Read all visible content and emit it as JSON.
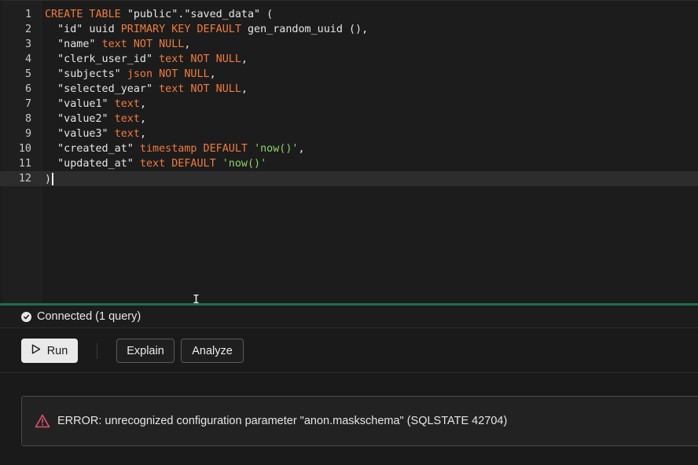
{
  "editor": {
    "lines": [
      {
        "n": "1",
        "tokens": [
          [
            "kw",
            "CREATE TABLE "
          ],
          [
            "str",
            "\"public\".\"saved_data\" ("
          ]
        ]
      },
      {
        "n": "2",
        "tokens": [
          [
            "str",
            "  \"id\" uuid "
          ],
          [
            "kw",
            "PRIMARY KEY DEFAULT "
          ],
          [
            "fn",
            "gen_random_uuid (),"
          ]
        ]
      },
      {
        "n": "3",
        "tokens": [
          [
            "str",
            "  \"name\" "
          ],
          [
            "kw",
            "text NOT NULL"
          ],
          [
            "str",
            ","
          ]
        ]
      },
      {
        "n": "4",
        "tokens": [
          [
            "str",
            "  \"clerk_user_id\" "
          ],
          [
            "kw",
            "text NOT NULL"
          ],
          [
            "str",
            ","
          ]
        ]
      },
      {
        "n": "5",
        "tokens": [
          [
            "str",
            "  \"subjects\" "
          ],
          [
            "kw",
            "json NOT NULL"
          ],
          [
            "str",
            ","
          ]
        ]
      },
      {
        "n": "6",
        "tokens": [
          [
            "str",
            "  \"selected_year\" "
          ],
          [
            "kw",
            "text NOT NULL"
          ],
          [
            "str",
            ","
          ]
        ]
      },
      {
        "n": "7",
        "tokens": [
          [
            "str",
            "  \"value1\" "
          ],
          [
            "kw",
            "text"
          ],
          [
            "str",
            ","
          ]
        ]
      },
      {
        "n": "8",
        "tokens": [
          [
            "str",
            "  \"value2\" "
          ],
          [
            "kw",
            "text"
          ],
          [
            "str",
            ","
          ]
        ]
      },
      {
        "n": "9",
        "tokens": [
          [
            "str",
            "  \"value3\" "
          ],
          [
            "kw",
            "text"
          ],
          [
            "str",
            ","
          ]
        ]
      },
      {
        "n": "10",
        "tokens": [
          [
            "str",
            "  \"created_at\" "
          ],
          [
            "kw",
            "timestamp DEFAULT "
          ],
          [
            "lit",
            "'now()'"
          ],
          [
            "str",
            ","
          ]
        ]
      },
      {
        "n": "11",
        "tokens": [
          [
            "str",
            "  \"updated_at\" "
          ],
          [
            "kw",
            "text DEFAULT "
          ],
          [
            "lit",
            "'now()'"
          ]
        ]
      },
      {
        "n": "12",
        "tokens": [
          [
            "str",
            ")"
          ]
        ],
        "active": true
      }
    ]
  },
  "status": {
    "text": "Connected (1 query)",
    "icon": "check-circle-icon"
  },
  "toolbar": {
    "run_label": "Run",
    "explain_label": "Explain",
    "analyze_label": "Analyze"
  },
  "result": {
    "error_text": "ERROR: unrecognized configuration parameter \"anon.maskschema\" (SQLSTATE 42704)",
    "icon": "warning-icon"
  },
  "colors": {
    "keyword": "#f07b3f",
    "literal": "#8bd36c",
    "divider": "#1f6f4a",
    "warning": "#e0546a"
  }
}
